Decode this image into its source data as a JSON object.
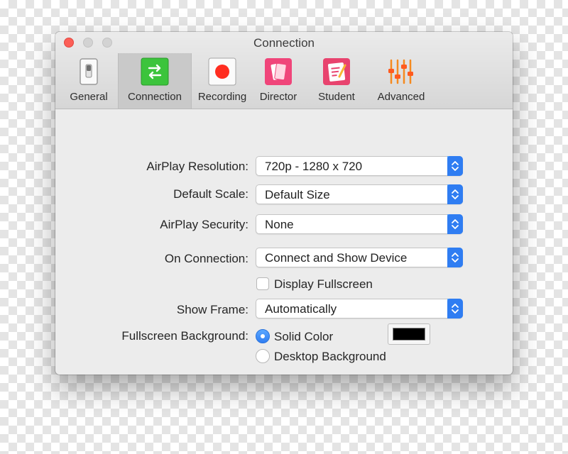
{
  "window": {
    "title": "Connection"
  },
  "toolbar": {
    "items": [
      {
        "label": "General",
        "icon": "switch-icon",
        "selected": false
      },
      {
        "label": "Connection",
        "icon": "arrows-icon",
        "selected": true
      },
      {
        "label": "Recording",
        "icon": "record-icon",
        "selected": false
      },
      {
        "label": "Director",
        "icon": "director-icon",
        "selected": false
      },
      {
        "label": "Student",
        "icon": "student-icon",
        "selected": false
      },
      {
        "label": "Advanced",
        "icon": "sliders-icon",
        "selected": false
      }
    ]
  },
  "settings": {
    "airplay_resolution": {
      "label": "AirPlay Resolution:",
      "value": "720p - 1280 x 720"
    },
    "default_scale": {
      "label": "Default Scale:",
      "value": "Default Size"
    },
    "airplay_security": {
      "label": "AirPlay Security:",
      "value": "None"
    },
    "on_connection": {
      "label": "On Connection:",
      "value": "Connect and Show Device"
    },
    "display_fullscreen": {
      "label": "Display Fullscreen",
      "checked": false
    },
    "show_frame": {
      "label": "Show Frame:",
      "value": "Automatically"
    },
    "fullscreen_background": {
      "label": "Fullscreen Background:",
      "options": [
        {
          "label": "Solid Color",
          "selected": true
        },
        {
          "label": "Desktop Background",
          "selected": false
        }
      ],
      "color": "#000000"
    }
  },
  "colors": {
    "accent": "#2f7df2",
    "close_button": "#fc5f57",
    "connection_icon": "#3cc43c",
    "record_red": "#ff2d20",
    "director_pink": "#f0457a",
    "student_pink": "#e8436e",
    "advanced_orange": "#f58a1f"
  }
}
